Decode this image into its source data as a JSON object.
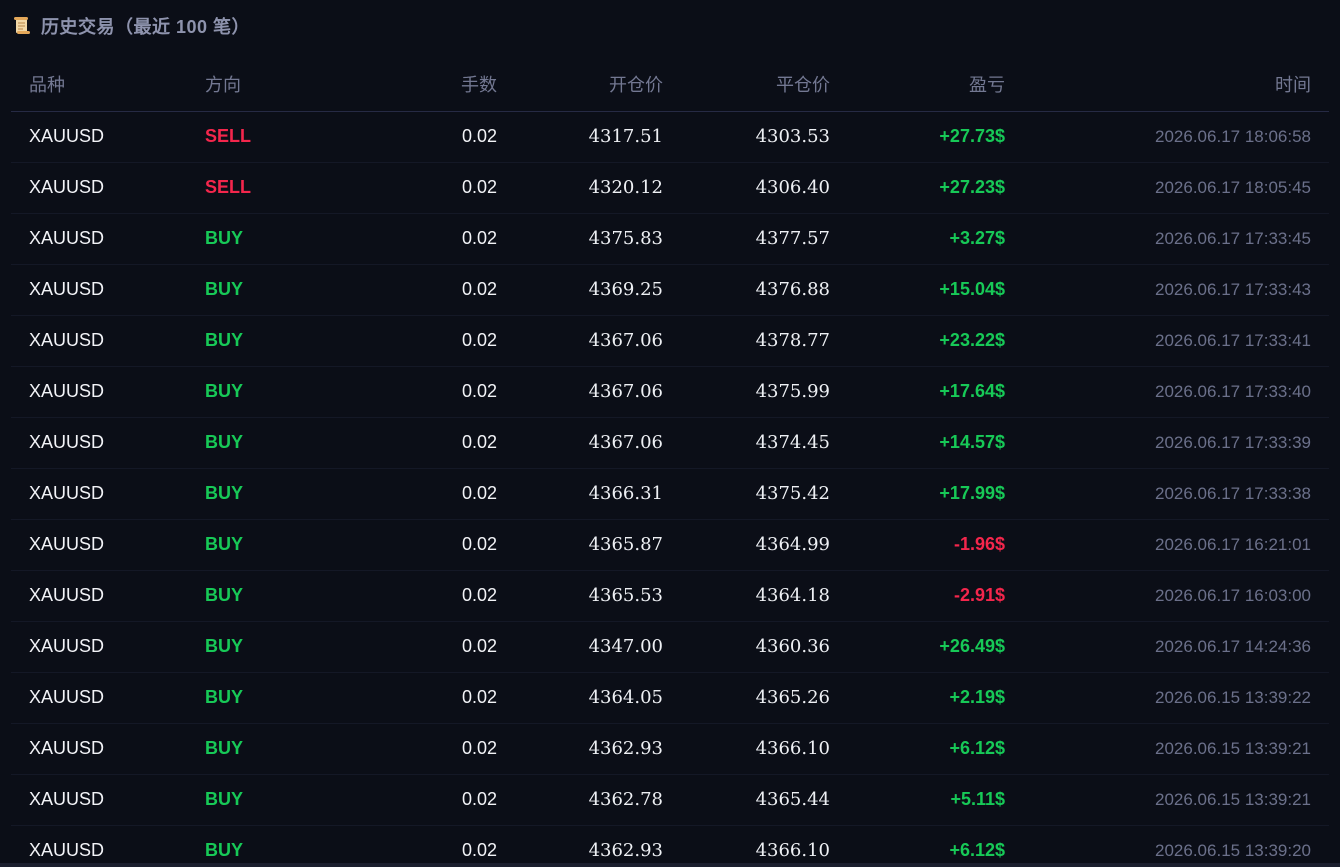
{
  "header": {
    "icon": "scroll-icon",
    "title": "历史交易（最近 100 笔）"
  },
  "colors": {
    "background": "#0b0e17",
    "buy": "#17c957",
    "sell": "#f4264c",
    "header_text": "#737892",
    "time_text": "#6b708a"
  },
  "columns": {
    "symbol": "品种",
    "direction": "方向",
    "lots": "手数",
    "open_price": "开仓价",
    "close_price": "平仓价",
    "pnl": "盈亏",
    "time": "时间"
  },
  "trades": [
    {
      "symbol": "XAUUSD",
      "direction": "SELL",
      "lots": "0.02",
      "open_price": "4317.51",
      "close_price": "4303.53",
      "pnl": "+27.73$",
      "time": "2026.06.17 18:06:58"
    },
    {
      "symbol": "XAUUSD",
      "direction": "SELL",
      "lots": "0.02",
      "open_price": "4320.12",
      "close_price": "4306.40",
      "pnl": "+27.23$",
      "time": "2026.06.17 18:05:45"
    },
    {
      "symbol": "XAUUSD",
      "direction": "BUY",
      "lots": "0.02",
      "open_price": "4375.83",
      "close_price": "4377.57",
      "pnl": "+3.27$",
      "time": "2026.06.17 17:33:45"
    },
    {
      "symbol": "XAUUSD",
      "direction": "BUY",
      "lots": "0.02",
      "open_price": "4369.25",
      "close_price": "4376.88",
      "pnl": "+15.04$",
      "time": "2026.06.17 17:33:43"
    },
    {
      "symbol": "XAUUSD",
      "direction": "BUY",
      "lots": "0.02",
      "open_price": "4367.06",
      "close_price": "4378.77",
      "pnl": "+23.22$",
      "time": "2026.06.17 17:33:41"
    },
    {
      "symbol": "XAUUSD",
      "direction": "BUY",
      "lots": "0.02",
      "open_price": "4367.06",
      "close_price": "4375.99",
      "pnl": "+17.64$",
      "time": "2026.06.17 17:33:40"
    },
    {
      "symbol": "XAUUSD",
      "direction": "BUY",
      "lots": "0.02",
      "open_price": "4367.06",
      "close_price": "4374.45",
      "pnl": "+14.57$",
      "time": "2026.06.17 17:33:39"
    },
    {
      "symbol": "XAUUSD",
      "direction": "BUY",
      "lots": "0.02",
      "open_price": "4366.31",
      "close_price": "4375.42",
      "pnl": "+17.99$",
      "time": "2026.06.17 17:33:38"
    },
    {
      "symbol": "XAUUSD",
      "direction": "BUY",
      "lots": "0.02",
      "open_price": "4365.87",
      "close_price": "4364.99",
      "pnl": "-1.96$",
      "time": "2026.06.17 16:21:01"
    },
    {
      "symbol": "XAUUSD",
      "direction": "BUY",
      "lots": "0.02",
      "open_price": "4365.53",
      "close_price": "4364.18",
      "pnl": "-2.91$",
      "time": "2026.06.17 16:03:00"
    },
    {
      "symbol": "XAUUSD",
      "direction": "BUY",
      "lots": "0.02",
      "open_price": "4347.00",
      "close_price": "4360.36",
      "pnl": "+26.49$",
      "time": "2026.06.17 14:24:36"
    },
    {
      "symbol": "XAUUSD",
      "direction": "BUY",
      "lots": "0.02",
      "open_price": "4364.05",
      "close_price": "4365.26",
      "pnl": "+2.19$",
      "time": "2026.06.15 13:39:22"
    },
    {
      "symbol": "XAUUSD",
      "direction": "BUY",
      "lots": "0.02",
      "open_price": "4362.93",
      "close_price": "4366.10",
      "pnl": "+6.12$",
      "time": "2026.06.15 13:39:21"
    },
    {
      "symbol": "XAUUSD",
      "direction": "BUY",
      "lots": "0.02",
      "open_price": "4362.78",
      "close_price": "4365.44",
      "pnl": "+5.11$",
      "time": "2026.06.15 13:39:21"
    },
    {
      "symbol": "XAUUSD",
      "direction": "BUY",
      "lots": "0.02",
      "open_price": "4362.93",
      "close_price": "4366.10",
      "pnl": "+6.12$",
      "time": "2026.06.15 13:39:20"
    }
  ]
}
